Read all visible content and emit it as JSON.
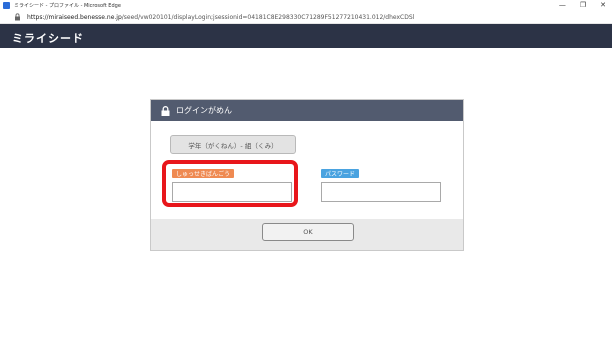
{
  "window": {
    "title": "ミライシード - プロファイル - Microsoft Edge",
    "controls": [
      "—",
      "❐",
      "✕"
    ]
  },
  "address": {
    "host": "https://miraiseed.benesse.ne.jp",
    "path": "/seed/vw020101/displayLogin;jsessionid=04181C8E298330C71289F51277210431.012/dhexCDSl"
  },
  "header": {
    "logo": "ミライシード"
  },
  "dialog": {
    "title": "ログインがめん",
    "class_button": "学年（がくねん）- 組（くみ）",
    "id_label": "しゅっせきばんごう",
    "password_label": "パスワード",
    "ok_label": "OK"
  },
  "colors": {
    "header_bg": "#2c3346",
    "dialog_header_bg": "#525b6f",
    "id_tag": "#ef8a52",
    "password_tag": "#4aa3e0",
    "highlight": "#e8161b"
  }
}
